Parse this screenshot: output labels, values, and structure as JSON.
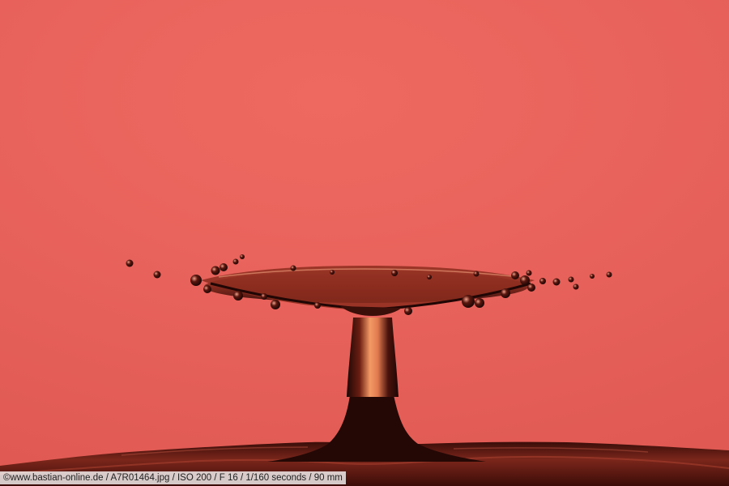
{
  "image": {
    "subject": "water drop splash",
    "background_color": "#e35c53",
    "liquid_color": "#2a0a08"
  },
  "caption": {
    "text": "©www.bastian-online.de / A7R01464.jpg / ISO 200 / F 16 / 1/160 seconds  / 90 mm"
  }
}
